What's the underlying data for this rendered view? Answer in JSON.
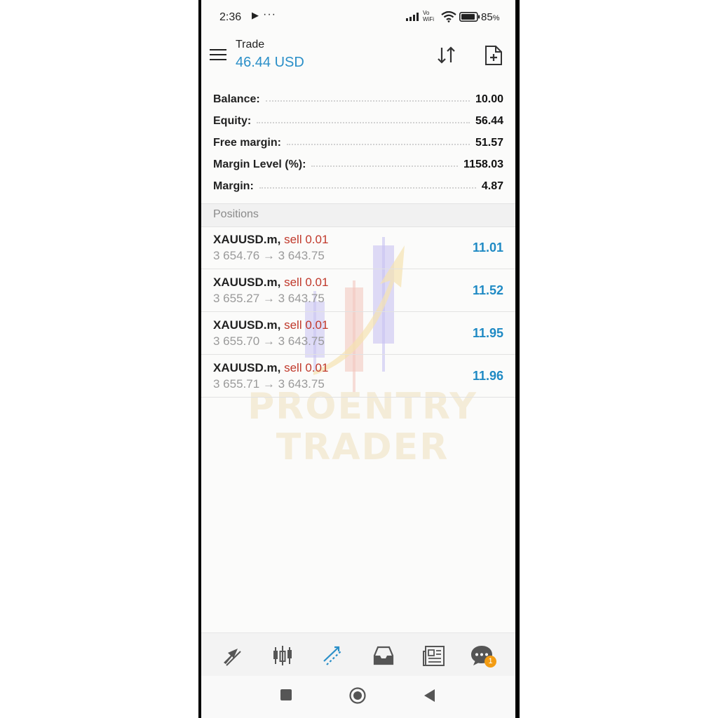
{
  "status_bar": {
    "time": "2:36",
    "dots": "···",
    "vowifi_top": "Vo",
    "vowifi_bottom": "WiFi",
    "battery": "85",
    "battery_unit": "%"
  },
  "header": {
    "title": "Trade",
    "subtitle": "46.44 USD"
  },
  "summary": [
    {
      "label": "Balance:",
      "value": "10.00"
    },
    {
      "label": "Equity:",
      "value": "56.44"
    },
    {
      "label": "Free margin:",
      "value": "51.57"
    },
    {
      "label": "Margin Level (%):",
      "value": "1158.03"
    },
    {
      "label": "Margin:",
      "value": "4.87"
    }
  ],
  "positions_header": "Positions",
  "positions": [
    {
      "symbol": "XAUUSD.m,",
      "side": "sell 0.01",
      "prices": "3 654.76 → 3 643.75",
      "profit": "11.01"
    },
    {
      "symbol": "XAUUSD.m,",
      "side": "sell 0.01",
      "prices": "3 655.27 → 3 643.75",
      "profit": "11.52"
    },
    {
      "symbol": "XAUUSD.m,",
      "side": "sell 0.01",
      "prices": "3 655.70 → 3 643.75",
      "profit": "11.95"
    },
    {
      "symbol": "XAUUSD.m,",
      "side": "sell 0.01",
      "prices": "3 655.71 → 3 643.75",
      "profit": "11.96"
    }
  ],
  "watermark": {
    "line1": "PROENTRY",
    "line2": "TRADER"
  },
  "bottom_nav": {
    "items": [
      "quotes-icon",
      "chart-icon",
      "trade-icon",
      "history-icon",
      "news-icon",
      "chat-icon"
    ],
    "active": "trade-icon",
    "chat_badge": "1"
  },
  "colors": {
    "accent": "#2a8fc8",
    "sell": "#c0392b",
    "profit": "#1f8ac4",
    "badge": "#f39c12"
  }
}
